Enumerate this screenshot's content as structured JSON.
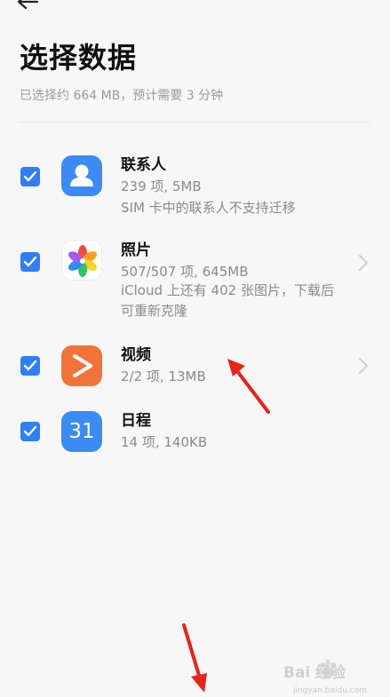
{
  "header": {
    "title": "选择数据",
    "subtitle": "已选择约 664 MB，预计需要 3 分钟"
  },
  "items": [
    {
      "name": "联系人",
      "detail": "239 项, 5MB",
      "note": "SIM 卡中的联系人不支持迁移",
      "checked": true,
      "icon": "contacts-icon"
    },
    {
      "name": "照片",
      "detail": "507/507 项, 645MB",
      "note": "iCloud 上还有 402 张图片，下载后可重新克隆",
      "checked": true,
      "icon": "photos-icon"
    },
    {
      "name": "视频",
      "detail": "2/2 项, 13MB",
      "checked": true,
      "icon": "video-icon"
    },
    {
      "name": "日程",
      "detail": "14 项, 140KB",
      "checked": true,
      "icon": "calendar-icon",
      "icon_text": "31"
    }
  ],
  "watermark": {
    "text": "Bai 经验",
    "url": "jingyan.baidu.com"
  },
  "colors": {
    "accent": "#2f7ef5",
    "annotation_arrow": "#e8231b"
  }
}
